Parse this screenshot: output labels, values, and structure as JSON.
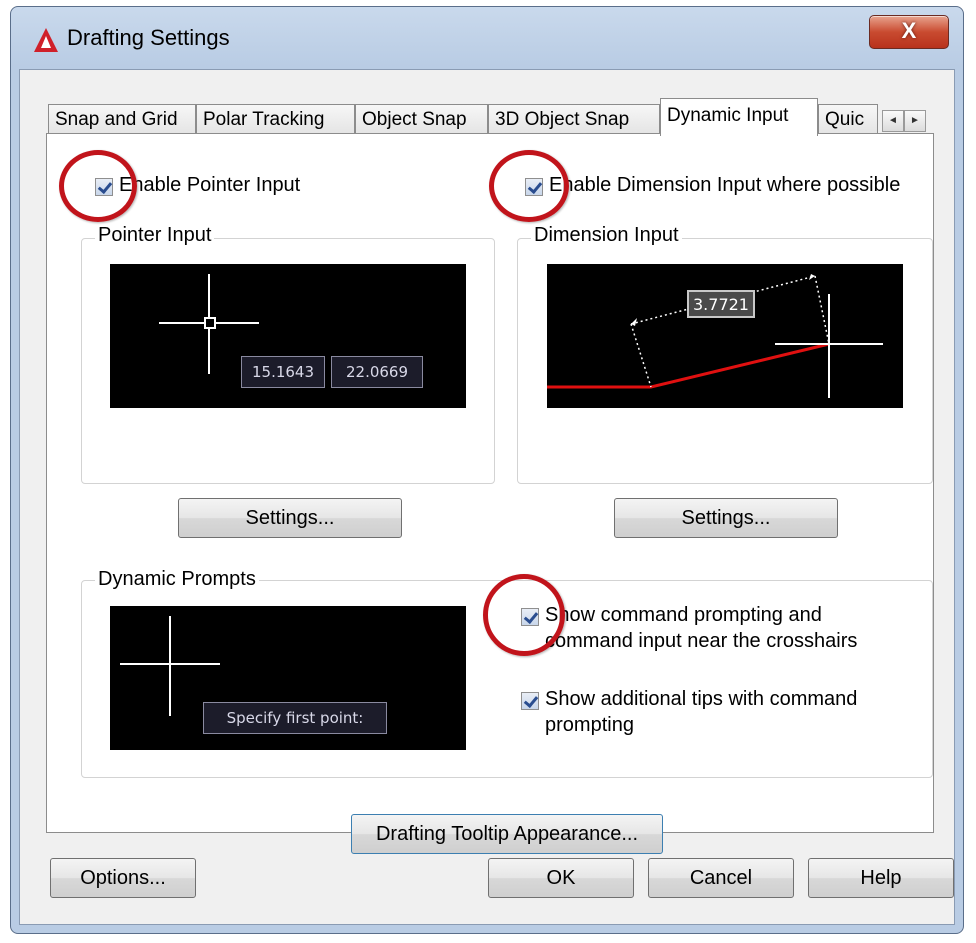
{
  "window": {
    "title": "Drafting Settings",
    "close_glyph": "X",
    "app_icon": "autocad-logo-icon"
  },
  "tabs": [
    {
      "label": "Snap and Grid"
    },
    {
      "label": "Polar Tracking"
    },
    {
      "label": "Object Snap"
    },
    {
      "label": "3D Object Snap"
    },
    {
      "label": "Dynamic Input",
      "active": true
    },
    {
      "label": "Quic"
    }
  ],
  "tab_scroll": {
    "left": "◄",
    "right": "►"
  },
  "pointer": {
    "checkbox_label": "Enable Pointer Input",
    "checked": true,
    "group_title": "Pointer Input",
    "x_value": "15.1643",
    "y_value": "22.0669",
    "settings_label": "Settings..."
  },
  "dimension": {
    "checkbox_label": "Enable Dimension Input where possible",
    "checked": true,
    "group_title": "Dimension Input",
    "value": "3.7721",
    "settings_label": "Settings..."
  },
  "prompts": {
    "group_title": "Dynamic Prompts",
    "preview_text": "Specify first point:",
    "show_command_label_1": "Show command prompting and",
    "show_command_label_2": "command input near the crosshairs",
    "show_command_checked": true,
    "show_tips_label_1": "Show additional tips with command",
    "show_tips_label_2": "prompting",
    "show_tips_checked": true
  },
  "tooltip_button": "Drafting Tooltip Appearance...",
  "footer": {
    "options": "Options...",
    "ok": "OK",
    "cancel": "Cancel",
    "help": "Help"
  },
  "colors": {
    "highlight_circle": "#c1141b",
    "dimension_line": "#e01010"
  }
}
